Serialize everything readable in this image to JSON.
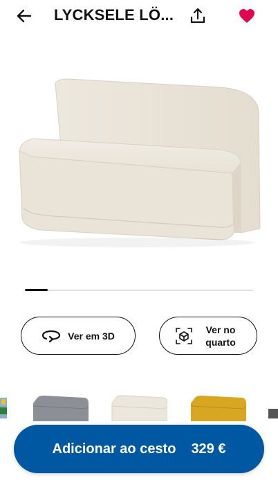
{
  "header": {
    "title": "LYCKSELE LÖ...",
    "back_icon": "arrow-left-icon",
    "share_icon": "share-icon",
    "favorite_icon": "heart-icon"
  },
  "gallery": {
    "image": "beige-sofa-bed",
    "progress": 0.1
  },
  "actions": {
    "view_3d": "Ver em 3D",
    "view_in_room": "Ver no quarto"
  },
  "variants": [
    {
      "color": "#8aaecb",
      "name": "blue-variant"
    },
    {
      "color": "#8c8f95",
      "name": "grey-variant"
    },
    {
      "color": "#e9e4d9",
      "name": "beige-variant"
    },
    {
      "color": "#d8a722",
      "name": "yellow-variant"
    },
    {
      "color": "#555555",
      "name": "dark-variant"
    }
  ],
  "cta": {
    "label": "Adicionar ao cesto",
    "price": "329 €"
  },
  "colors": {
    "brand_blue": "#0058a3",
    "favorite_red": "#e00751"
  }
}
